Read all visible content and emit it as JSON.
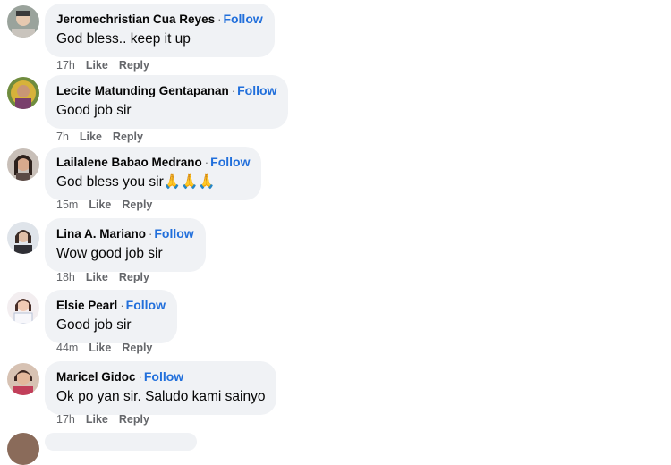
{
  "comments": [
    {
      "author": "Jeromechristian Cua Reyes",
      "follow_label": "Follow",
      "text": "God bless.. keep it up",
      "time": "17h",
      "like_label": "Like",
      "reply_label": "Reply",
      "avatar_icon": "user-avatar-icon"
    },
    {
      "author": "Lecite Matunding Gentapanan",
      "follow_label": "Follow",
      "text": "Good job sir",
      "time": "7h",
      "like_label": "Like",
      "reply_label": "Reply",
      "avatar_icon": "user-avatar-icon"
    },
    {
      "author": "Lailalene Babao Medrano",
      "follow_label": "Follow",
      "text": "God bless you sir🙏🙏🙏",
      "time": "15m",
      "like_label": "Like",
      "reply_label": "Reply",
      "avatar_icon": "user-avatar-icon"
    },
    {
      "author": "Lina A. Mariano",
      "follow_label": "Follow",
      "text": "Wow good job sir",
      "time": "18h",
      "like_label": "Like",
      "reply_label": "Reply",
      "avatar_icon": "user-avatar-icon"
    },
    {
      "author": "Elsie Pearl",
      "follow_label": "Follow",
      "text": "Good job sir",
      "time": "44m",
      "like_label": "Like",
      "reply_label": "Reply",
      "avatar_icon": "user-avatar-icon"
    },
    {
      "author": "Maricel Gidoc",
      "follow_label": "Follow",
      "text": "Ok po yan sir. Saludo kami sainyo",
      "time": "17h",
      "like_label": "Like",
      "reply_label": "Reply",
      "avatar_icon": "user-avatar-icon"
    }
  ],
  "colors": {
    "bubble_bg": "#f0f2f5",
    "follow_link": "#216fdb",
    "meta_text": "#65676b",
    "primary_text": "#050505"
  }
}
